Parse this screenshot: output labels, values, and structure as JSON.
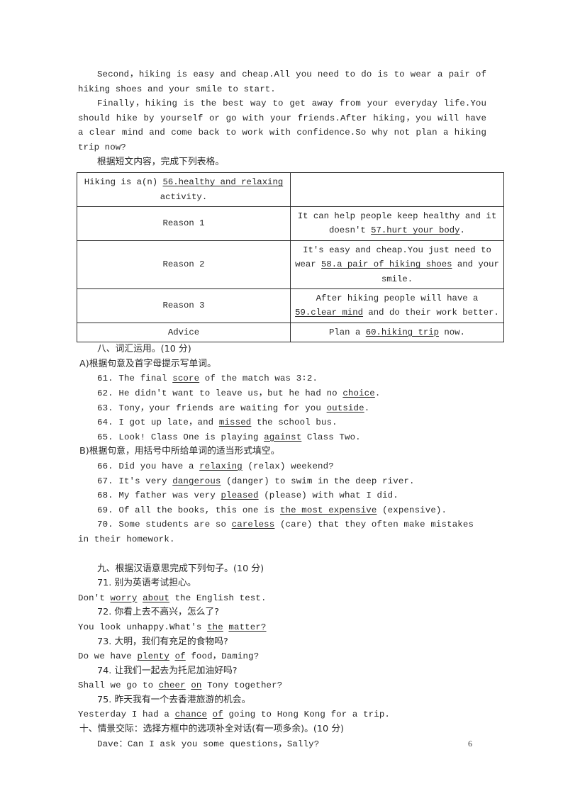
{
  "document": {
    "page_number": "6"
  },
  "passage": {
    "paragraph_1": "Second，hiking is easy and cheap.All you need to do is to wear a pair of hiking shoes and your smile to start.",
    "paragraph_2": "Finally，hiking is the best way to get away from your everyday life.You should hike by yourself or go with your friends.After hiking，you will have a clear mind and come back to work with confidence.So why not plan a hiking trip now?",
    "table_instruction": "根据短文内容，完成下列表格。"
  },
  "table": {
    "topic_prefix": "Hiking is a(n)",
    "topic_answer": "56.healthy and relaxing",
    "topic_suffix": "activity.",
    "rows": [
      {
        "label": "Reason 1",
        "text_before": "It can help people keep healthy and it doesn't",
        "answer": "57.hurt your body",
        "text_after": "."
      },
      {
        "label": "Reason 2",
        "text_before": "It's easy and cheap.You just need to wear",
        "answer": "58.a pair of hiking shoes",
        "text_after": "and your smile."
      },
      {
        "label": "Reason 3",
        "text_before": "After hiking people will have a",
        "answer": "59.clear mind",
        "text_after": "and do their work better."
      },
      {
        "label": "Advice",
        "text_before": "Plan a",
        "answer": "60.hiking trip",
        "text_after": "now."
      }
    ]
  },
  "section_eight": {
    "heading": "八、词汇运用。(10 分)",
    "sub_a": "A)根据句意及首字母提示写单词。",
    "sub_b": "B)根据句意，用括号中所给单词的适当形式填空。",
    "items_a": [
      {
        "num": "61.",
        "before": "The final",
        "answer": "score",
        "after": "of the match was 3∶2."
      },
      {
        "num": "62.",
        "before": "He didn't want to leave us，but he had no",
        "answer": "choice",
        "after": "."
      },
      {
        "num": "63.",
        "before": "Tony，your friends are waiting for you",
        "answer": "outside",
        "after": "."
      },
      {
        "num": "64.",
        "before": "I got up late，and",
        "answer": "missed",
        "after": "the school bus."
      },
      {
        "num": "65.",
        "before": "Look! Class One is playing",
        "answer": "against",
        "after": "Class Two."
      }
    ],
    "items_b": [
      {
        "num": "66.",
        "before": "Did you have a",
        "answer": "relaxing",
        "after": "(relax) weekend?"
      },
      {
        "num": "67.",
        "before": "It's very",
        "answer": "dangerous",
        "after": "(danger) to swim in the deep river."
      },
      {
        "num": "68.",
        "before": "My father was very",
        "answer": "pleased",
        "after": "(please) with what I did."
      },
      {
        "num": "69.",
        "before": "Of all the books, this one is",
        "answer": "the most expensive",
        "after": "(expensive)."
      },
      {
        "num": "70.",
        "before": "Some students are so",
        "answer": "careless",
        "after": "(care) that they often make mistakes in their homework."
      }
    ]
  },
  "section_nine": {
    "heading": "九、根据汉语意思完成下列句子。(10 分)",
    "items": [
      {
        "num": "71.",
        "chinese": "别为英语考试担心。",
        "before": "Don't",
        "answer1": "worry",
        "answer2": "about",
        "after": "the English test."
      },
      {
        "num": "72.",
        "chinese": "你看上去不高兴，怎么了?",
        "before": "You look unhappy.What's",
        "answer1": "the",
        "answer2": "matter?",
        "after": ""
      },
      {
        "num": "73.",
        "chinese": "大明，我们有充足的食物吗?",
        "before": "Do we have",
        "answer1": "plenty",
        "answer2": "of",
        "after": "food，Daming?"
      },
      {
        "num": "74.",
        "chinese": "让我们一起去为托尼加油好吗?",
        "before": "Shall we go to",
        "answer1": "cheer",
        "answer2": "on",
        "after": "Tony together?"
      },
      {
        "num": "75.",
        "chinese": "昨天我有一个去香港旅游的机会。",
        "before": "Yesterday I had a",
        "answer1": "chance",
        "answer2": "of",
        "after": "going to Hong Kong for a trip."
      }
    ]
  },
  "section_ten": {
    "heading": "十、情景交际：选择方框中的选项补全对话(有一项多余)。(10 分)",
    "dialogue_line": "Dave：Can I ask you some questions，Sally?"
  }
}
